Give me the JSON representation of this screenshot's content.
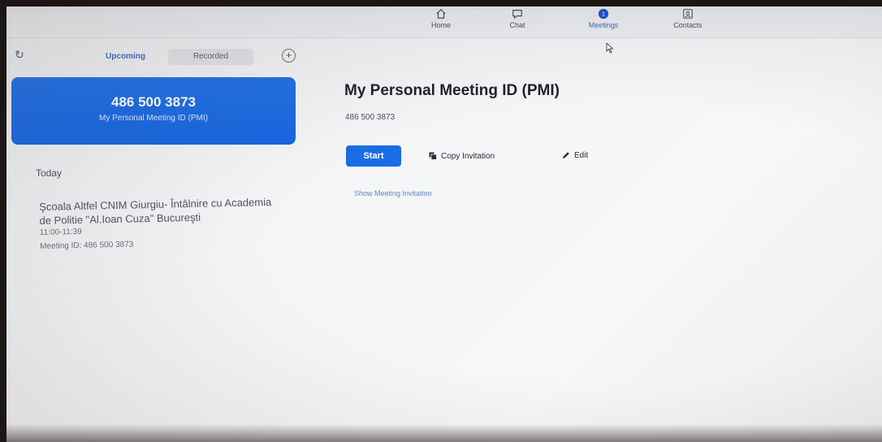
{
  "nav": {
    "items": [
      {
        "label": "Home",
        "icon": "home-icon"
      },
      {
        "label": "Chat",
        "icon": "chat-icon"
      },
      {
        "label": "Meetings",
        "icon": "meetings-icon"
      },
      {
        "label": "Contacts",
        "icon": "contacts-icon"
      }
    ],
    "active": "Meetings"
  },
  "sidebar": {
    "tabs": [
      {
        "label": "Upcoming",
        "active": true
      },
      {
        "label": "Recorded",
        "active": false
      }
    ],
    "pmi_card": {
      "number": "486 500 3873",
      "label": "My Personal Meeting ID (PMI)"
    },
    "section_label": "Today",
    "meetings": [
      {
        "title": "Şcoala Altfel CNIM Giurgiu- Întâlnire cu Academia de Politie \"Al.Ioan Cuza\" Bucureşti",
        "time": "11:00-11:39",
        "meeting_id": "Meeting ID: 486 500 3873"
      }
    ]
  },
  "main": {
    "title": "My Personal Meeting ID (PMI)",
    "pmi_id": "486 500 3873",
    "start_label": "Start",
    "copy_label": "Copy Invitation",
    "edit_label": "Edit",
    "show_invitation_label": "Show Meeting Invitation"
  },
  "colors": {
    "accent": "#1a6de6",
    "link": "#5f86c8",
    "tab_active": "#3a6ab5"
  }
}
